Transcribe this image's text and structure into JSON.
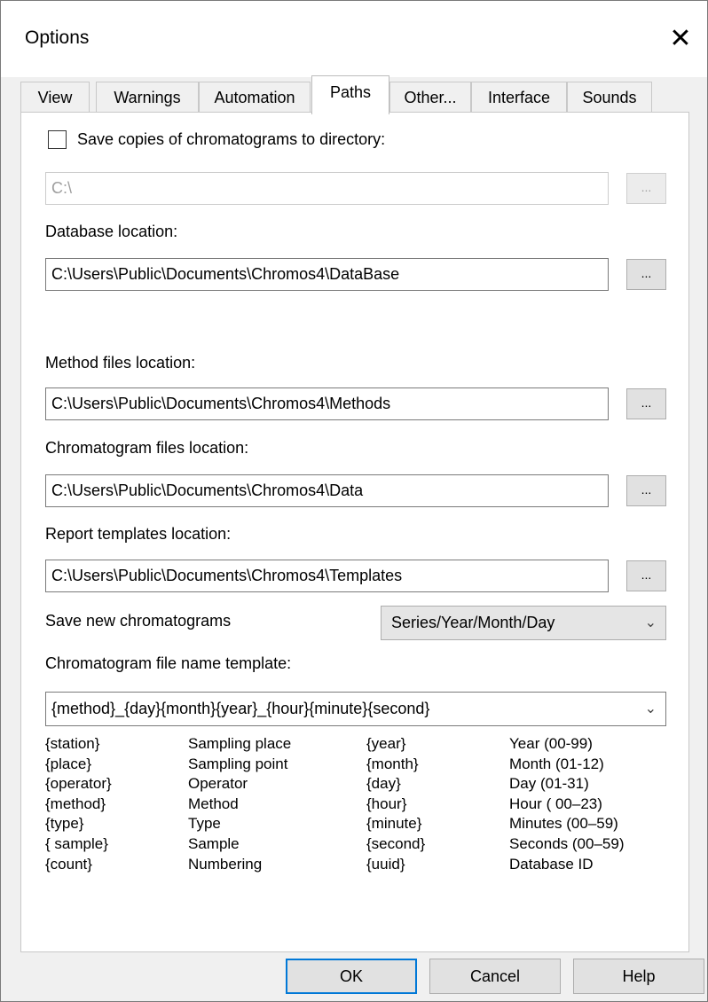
{
  "window": {
    "title": "Options",
    "close_glyph": "✕"
  },
  "tabs": [
    {
      "label": "View"
    },
    {
      "label": "Warnings"
    },
    {
      "label": "Automation"
    },
    {
      "label": "Paths"
    },
    {
      "label": "Other..."
    },
    {
      "label": "Interface"
    },
    {
      "label": "Sounds"
    }
  ],
  "active_tab": "Paths",
  "paths": {
    "save_copies_label": "Save copies of chromatograms to directory:",
    "save_copies_checked": false,
    "save_copies_path": "C:\\",
    "database_label": "Database location:",
    "database_path": "C:\\Users\\Public\\Documents\\Chromos4\\DataBase",
    "method_label": "Method files location:",
    "method_path": "C:\\Users\\Public\\Documents\\Chromos4\\Methods",
    "chromatogram_label": "Chromatogram files location:",
    "chromatogram_path": "C:\\Users\\Public\\Documents\\Chromos4\\Data",
    "report_label": "Report templates location:",
    "report_path": "C:\\Users\\Public\\Documents\\Chromos4\\Templates",
    "browse_label": "...",
    "save_new_label": "Save new chromatograms",
    "save_new_value": "Series/Year/Month/Day",
    "template_label": "Chromatogram file name template:",
    "template_value": "{method}_{day}{month}{year}_{hour}{minute}{second}"
  },
  "legend": {
    "col1": [
      {
        "token": "{station}",
        "desc": "Sampling place"
      },
      {
        "token": "{place}",
        "desc": "Sampling point"
      },
      {
        "token": "{operator}",
        "desc": "Operator"
      },
      {
        "token": "{method}",
        "desc": "Method"
      },
      {
        "token": "{type}",
        "desc": "Type"
      },
      {
        "token": "{ sample}",
        "desc": "Sample"
      },
      {
        "token": "{count}",
        "desc": "Numbering"
      }
    ],
    "col2": [
      {
        "token": "{year}",
        "desc": "Year (00-99)"
      },
      {
        "token": "{month}",
        "desc": "Month (01-12)"
      },
      {
        "token": "{day}",
        "desc": "Day (01-31)"
      },
      {
        "token": "{hour}",
        "desc": "Hour ( 00–23)"
      },
      {
        "token": "{minute}",
        "desc": "Minutes (00–59)"
      },
      {
        "token": "{second}",
        "desc": "Seconds (00–59)"
      },
      {
        "token": "{uuid}",
        "desc": "Database ID"
      }
    ]
  },
  "buttons": {
    "ok": "OK",
    "cancel": "Cancel",
    "help": "Help"
  }
}
